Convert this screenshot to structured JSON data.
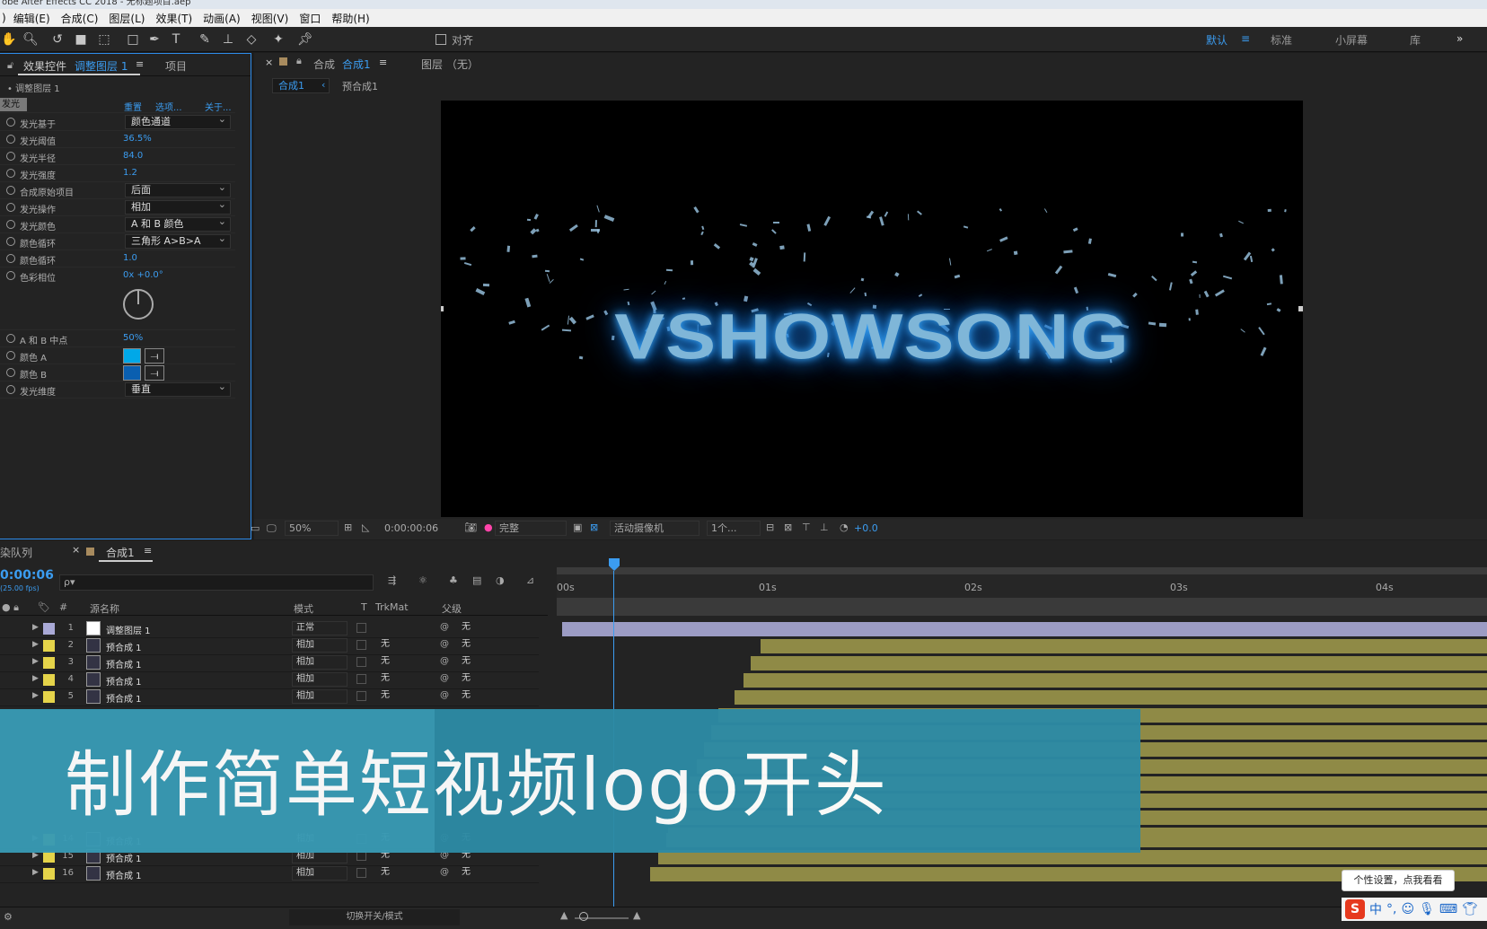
{
  "window": {
    "title": "obe After Effects CC 2018 - 无标题项目.aep"
  },
  "menu": [
    "编辑(E)",
    "合成(C)",
    "图层(L)",
    "效果(T)",
    "动画(A)",
    "视图(V)",
    "窗口",
    "帮助(H)"
  ],
  "menu_lead": ")",
  "toolbar": {
    "align_label": "对齐",
    "workspaces": [
      "默认",
      "标准",
      "小屏幕",
      "库"
    ],
    "overflow": "»"
  },
  "effects_panel": {
    "tab_prefix": "效果控件",
    "tab_layer": "调整图层 1",
    "tab_project": "项目",
    "breadcrumb": "• 调整图层 1",
    "effect_name": "发光",
    "reset": "重置",
    "options": "选项...",
    "about": "关于...",
    "props": [
      {
        "label": "发光基于",
        "dropdown": "颜色通道"
      },
      {
        "label": "发光阈值",
        "value": "36.5%"
      },
      {
        "label": "发光半径",
        "value": "84.0"
      },
      {
        "label": "发光强度",
        "value": "1.2"
      },
      {
        "label": "合成原始项目",
        "dropdown": "后面"
      },
      {
        "label": "发光操作",
        "dropdown": "相加"
      },
      {
        "label": "发光颜色",
        "dropdown": "A 和 B 颜色"
      },
      {
        "label": "颜色循环",
        "dropdown": "三角形 A>B>A"
      },
      {
        "label": "颜色循环",
        "value": "1.0"
      },
      {
        "label": "色彩相位",
        "value": "0x +0.0°"
      }
    ],
    "ab_mid": {
      "label": "A 和 B 中点",
      "value": "50%"
    },
    "color_a": {
      "label": "颜色 A",
      "color": "#00a8e8"
    },
    "color_b": {
      "label": "颜色 B",
      "color": "#0a5fb0"
    },
    "dimension": {
      "label": "发光维度",
      "dropdown": "垂直"
    }
  },
  "viewer": {
    "tab_comp_prefix": "合成",
    "tab_comp": "合成1",
    "tab_layer": "图层 （无）",
    "sub_tab_active": "合成1",
    "sub_tab": "预合成1",
    "logo_text": "VSHOWSONG",
    "zoom": "50%",
    "timecode": "0:00:00:06",
    "resolution": "完整",
    "camera": "活动摄像机",
    "views": "1个...",
    "exposure": "+0.0"
  },
  "timeline": {
    "render_tab": "染队列",
    "comp_tab": "合成1",
    "timecode": "0:00:06",
    "fps": "(25.00 fps)",
    "search_placeholder": "ρ▾",
    "columns": {
      "num": "#",
      "source": "源名称",
      "mode": "模式",
      "t": "T",
      "trkmat": "TrkMat",
      "parent": "父级"
    },
    "ruler": [
      "00s",
      "01s",
      "02s",
      "03s",
      "04s"
    ],
    "layers": [
      {
        "num": "1",
        "name": "调整图层 1",
        "mode": "正常",
        "trk": "",
        "parent": "无",
        "color": "#a9a9d6"
      },
      {
        "num": "2",
        "name": "预合成 1",
        "mode": "相加",
        "trk": "无",
        "parent": "无",
        "color": "#e5d44a"
      },
      {
        "num": "3",
        "name": "预合成 1",
        "mode": "相加",
        "trk": "无",
        "parent": "无",
        "color": "#e5d44a"
      },
      {
        "num": "4",
        "name": "预合成 1",
        "mode": "相加",
        "trk": "无",
        "parent": "无",
        "color": "#e5d44a"
      },
      {
        "num": "5",
        "name": "预合成 1",
        "mode": "相加",
        "trk": "无",
        "parent": "无",
        "color": "#e5d44a"
      },
      {
        "num": "14",
        "name": "预合成 1",
        "mode": "相加",
        "trk": "无",
        "parent": "无",
        "color": "#e5d44a"
      },
      {
        "num": "15",
        "name": "预合成 1",
        "mode": "相加",
        "trk": "无",
        "parent": "无",
        "color": "#e5d44a"
      },
      {
        "num": "16",
        "name": "预合成 1",
        "mode": "相加",
        "trk": "无",
        "parent": "无",
        "color": "#e5d44a"
      }
    ],
    "toggle_label": "切换开关/模式"
  },
  "banner": {
    "text": "制作简单短视频logo开头"
  },
  "tooltip": {
    "text": "个性设置，点我看看"
  },
  "ime": {
    "logo": "S",
    "lang": "中",
    "punct": "°,"
  }
}
